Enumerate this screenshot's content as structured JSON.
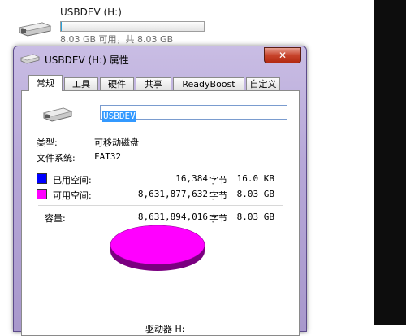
{
  "explorer": {
    "drive_name": "USBDEV (H:)",
    "drive_space": "8.03 GB 可用，共 8.03 GB",
    "usage_fraction": 0.004
  },
  "dialog": {
    "title": "USBDEV (H:) 属性",
    "close_label": "✕",
    "tabs": [
      "常规",
      "工具",
      "硬件",
      "共享",
      "ReadyBoost",
      "自定义"
    ],
    "active_tab": "常规",
    "name_value": "USBDEV",
    "type_label": "类型:",
    "type_value": "可移动磁盘",
    "fs_label": "文件系统:",
    "fs_value": "FAT32",
    "used_label": "已用空间:",
    "used_bytes": "16,384",
    "used_unit": "字节",
    "used_size": "16.0 KB",
    "free_label": "可用空间:",
    "free_bytes": "8,631,877,632",
    "free_unit": "字节",
    "free_size": "8.03 GB",
    "capacity_label": "容量:",
    "capacity_bytes": "8,631,894,016",
    "capacity_unit": "字节",
    "capacity_size": "8.03 GB",
    "drive_label": "驱动器 H:",
    "used_color": "#0000ff",
    "free_color": "#ff00ff"
  }
}
